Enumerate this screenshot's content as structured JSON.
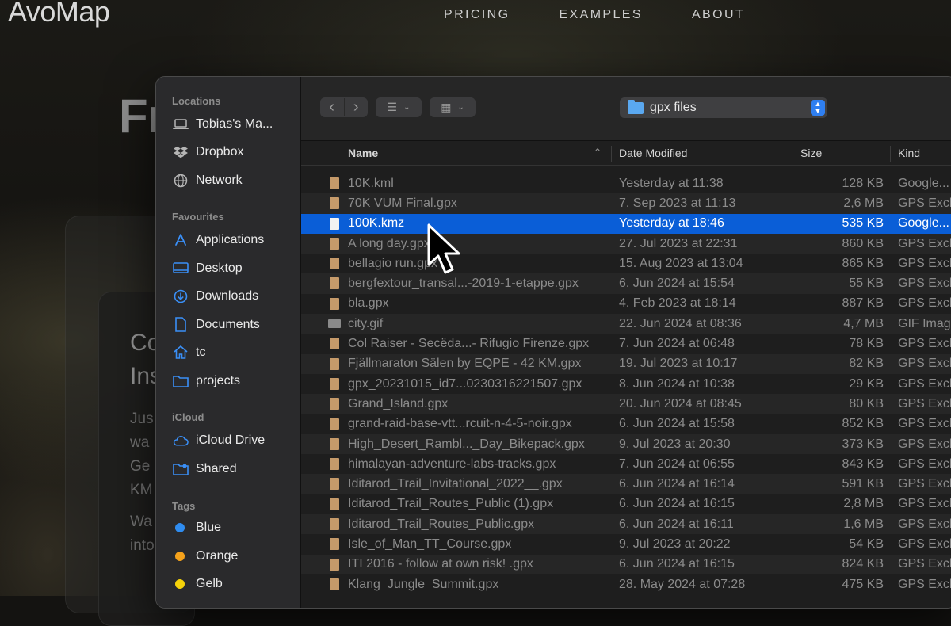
{
  "website": {
    "logo": "AvoMap",
    "nav": [
      "PRICING",
      "EXAMPLES",
      "ABOUT"
    ],
    "hero_partial": "Fr",
    "card_title_lines": [
      "Co",
      "Ins"
    ],
    "card_body_lines": [
      "Jus",
      "wa",
      "Ge",
      "KM",
      "",
      "Wa",
      "into"
    ]
  },
  "dialog": {
    "sidebar": {
      "locations_label": "Locations",
      "locations": [
        {
          "label": "Tobias's Ma...",
          "icon": "laptop-icon"
        },
        {
          "label": "Dropbox",
          "icon": "dropbox-icon"
        },
        {
          "label": "Network",
          "icon": "globe-icon"
        }
      ],
      "favourites_label": "Favourites",
      "favourites": [
        {
          "label": "Applications",
          "icon": "applications-icon"
        },
        {
          "label": "Desktop",
          "icon": "desktop-icon"
        },
        {
          "label": "Downloads",
          "icon": "downloads-icon"
        },
        {
          "label": "Documents",
          "icon": "documents-icon"
        },
        {
          "label": "tc",
          "icon": "home-icon"
        },
        {
          "label": "projects",
          "icon": "folder-icon"
        }
      ],
      "icloud_label": "iCloud",
      "icloud": [
        {
          "label": "iCloud Drive",
          "icon": "cloud-icon"
        },
        {
          "label": "Shared",
          "icon": "shared-folder-icon"
        }
      ],
      "tags_label": "Tags",
      "tags": [
        {
          "label": "Blue",
          "color": "#2f8cf0"
        },
        {
          "label": "Orange",
          "color": "#f5a21b"
        },
        {
          "label": "Gelb",
          "color": "#f5d20a"
        }
      ]
    },
    "toolbar": {
      "back": "‹",
      "forward": "›",
      "list_view": "☰",
      "grid_view": "▦",
      "current_folder": "gpx files"
    },
    "columns": {
      "name": "Name",
      "date": "Date Modified",
      "size": "Size",
      "kind": "Kind"
    },
    "files": [
      {
        "name": "10K.kml",
        "date": "Yesterday at 11:38",
        "size": "128 KB",
        "kind": "Google...",
        "type": "doc"
      },
      {
        "name": "70K VUM Final.gpx",
        "date": "7. Sep 2023 at 11:13",
        "size": "2,6 MB",
        "kind": "GPS Exch",
        "type": "doc"
      },
      {
        "name": "100K.kmz",
        "date": "Yesterday at 18:46",
        "size": "535 KB",
        "kind": "Google...",
        "type": "kmz",
        "selected": true
      },
      {
        "name": "A long day.gpx",
        "date": "27. Jul 2023 at 22:31",
        "size": "860 KB",
        "kind": "GPS Exch",
        "type": "doc"
      },
      {
        "name": "bellagio run.gpx",
        "date": "15. Aug 2023 at 13:04",
        "size": "865 KB",
        "kind": "GPS Exch",
        "type": "doc"
      },
      {
        "name": "bergfextour_transal...-2019-1-etappe.gpx",
        "date": "6. Jun 2024 at 15:54",
        "size": "55 KB",
        "kind": "GPS Exch",
        "type": "doc"
      },
      {
        "name": "bla.gpx",
        "date": "4. Feb 2023 at 18:14",
        "size": "887 KB",
        "kind": "GPS Exch",
        "type": "doc"
      },
      {
        "name": "city.gif",
        "date": "22. Jun 2024 at 08:36",
        "size": "4,7 MB",
        "kind": "GIF Imag",
        "type": "gif"
      },
      {
        "name": "Col Raiser - Secëda...- Rifugio Firenze.gpx",
        "date": "7. Jun 2024 at 06:48",
        "size": "78 KB",
        "kind": "GPS Exch",
        "type": "doc"
      },
      {
        "name": "Fjällmaraton Sälen by EQPE - 42 KM.gpx",
        "date": "19. Jul 2023 at 10:17",
        "size": "82 KB",
        "kind": "GPS Exch",
        "type": "doc"
      },
      {
        "name": "gpx_20231015_id7...0230316221507.gpx",
        "date": "8. Jun 2024 at 10:38",
        "size": "29 KB",
        "kind": "GPS Exch",
        "type": "doc"
      },
      {
        "name": "Grand_Island.gpx",
        "date": "20. Jun 2024 at 08:45",
        "size": "80 KB",
        "kind": "GPS Exch",
        "type": "doc"
      },
      {
        "name": "grand-raid-base-vtt...rcuit-n-4-5-noir.gpx",
        "date": "6. Jun 2024 at 15:58",
        "size": "852 KB",
        "kind": "GPS Exch",
        "type": "doc"
      },
      {
        "name": "High_Desert_Rambl..._Day_Bikepack.gpx",
        "date": "9. Jul 2023 at 20:30",
        "size": "373 KB",
        "kind": "GPS Exch",
        "type": "doc"
      },
      {
        "name": "himalayan-adventure-labs-tracks.gpx",
        "date": "7. Jun 2024 at 06:55",
        "size": "843 KB",
        "kind": "GPS Exch",
        "type": "doc"
      },
      {
        "name": "Iditarod_Trail_Invitational_2022__.gpx",
        "date": "6. Jun 2024 at 16:14",
        "size": "591 KB",
        "kind": "GPS Exch",
        "type": "doc"
      },
      {
        "name": "Iditarod_Trail_Routes_Public (1).gpx",
        "date": "6. Jun 2024 at 16:15",
        "size": "2,8 MB",
        "kind": "GPS Exch",
        "type": "doc"
      },
      {
        "name": "Iditarod_Trail_Routes_Public.gpx",
        "date": "6. Jun 2024 at 16:11",
        "size": "1,6 MB",
        "kind": "GPS Exch",
        "type": "doc"
      },
      {
        "name": "Isle_of_Man_TT_Course.gpx",
        "date": "9. Jul 2023 at 20:22",
        "size": "54 KB",
        "kind": "GPS Exch",
        "type": "doc"
      },
      {
        "name": "ITI 2016 - follow at own risk! .gpx",
        "date": "6. Jun 2024 at 16:15",
        "size": "824 KB",
        "kind": "GPS Exch",
        "type": "doc"
      },
      {
        "name": "Klang_Jungle_Summit.gpx",
        "date": "28. May 2024 at 07:28",
        "size": "475 KB",
        "kind": "GPS Exch",
        "type": "doc"
      }
    ]
  }
}
